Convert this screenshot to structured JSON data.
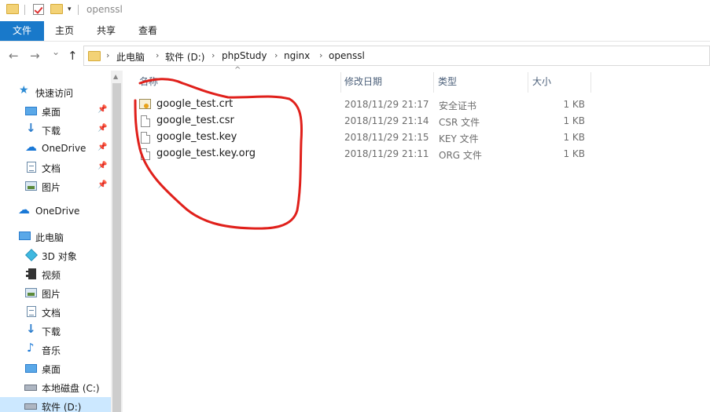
{
  "title": {
    "text": "openssl",
    "folder_icon": "folder-icon",
    "properties_icon": "properties-check-icon",
    "new_folder_icon": "new-folder-icon",
    "dropdown_icon": "caret-down-icon"
  },
  "ribbon": {
    "tabs": [
      {
        "label": "文件"
      },
      {
        "label": "主页"
      },
      {
        "label": "共享"
      },
      {
        "label": "查看"
      }
    ],
    "file_tab_color": "#1979ca"
  },
  "nav_buttons": {
    "back": "←",
    "forward": "→",
    "recent": "⌄",
    "up": "↑"
  },
  "breadcrumb": {
    "items": [
      "此电脑",
      "软件 (D:)",
      "phpStudy",
      "nginx",
      "openssl"
    ],
    "separator": "›"
  },
  "nav_pane": {
    "quick_access": {
      "label": "快速访问",
      "items": [
        {
          "label": "桌面",
          "icon": "desktop-icon",
          "pinned": true
        },
        {
          "label": "下载",
          "icon": "download-icon",
          "pinned": true
        },
        {
          "label": "OneDrive",
          "icon": "onedrive-icon",
          "pinned": true
        },
        {
          "label": "文档",
          "icon": "documents-icon",
          "pinned": true
        },
        {
          "label": "图片",
          "icon": "pictures-icon",
          "pinned": true
        }
      ]
    },
    "onedrive": {
      "label": "OneDrive"
    },
    "this_pc": {
      "label": "此电脑",
      "items": [
        {
          "label": "3D 对象",
          "icon": "3d-objects-icon"
        },
        {
          "label": "视频",
          "icon": "videos-icon"
        },
        {
          "label": "图片",
          "icon": "pictures-icon"
        },
        {
          "label": "文档",
          "icon": "documents-icon"
        },
        {
          "label": "下载",
          "icon": "download-icon"
        },
        {
          "label": "音乐",
          "icon": "music-icon"
        },
        {
          "label": "桌面",
          "icon": "desktop-icon"
        },
        {
          "label": "本地磁盘 (C:)",
          "icon": "local-disk-icon"
        },
        {
          "label": "软件 (D:)",
          "icon": "drive-icon",
          "selected": true
        }
      ]
    },
    "pin_glyph": "📌"
  },
  "columns": {
    "name": "名称",
    "modified": "修改日期",
    "type": "类型",
    "size": "大小"
  },
  "files": [
    {
      "name": "google_test.crt",
      "modified": "2018/11/29 21:17",
      "type": "安全证书",
      "size": "1 KB",
      "icon": "certificate-icon"
    },
    {
      "name": "google_test.csr",
      "modified": "2018/11/29 21:14",
      "type": "CSR 文件",
      "size": "1 KB",
      "icon": "file-icon"
    },
    {
      "name": "google_test.key",
      "modified": "2018/11/29 21:15",
      "type": "KEY 文件",
      "size": "1 KB",
      "icon": "file-icon"
    },
    {
      "name": "google_test.key.org",
      "modified": "2018/11/29 21:11",
      "type": "ORG 文件",
      "size": "1 KB",
      "icon": "file-icon"
    }
  ],
  "annotation_color": "#e0201b"
}
